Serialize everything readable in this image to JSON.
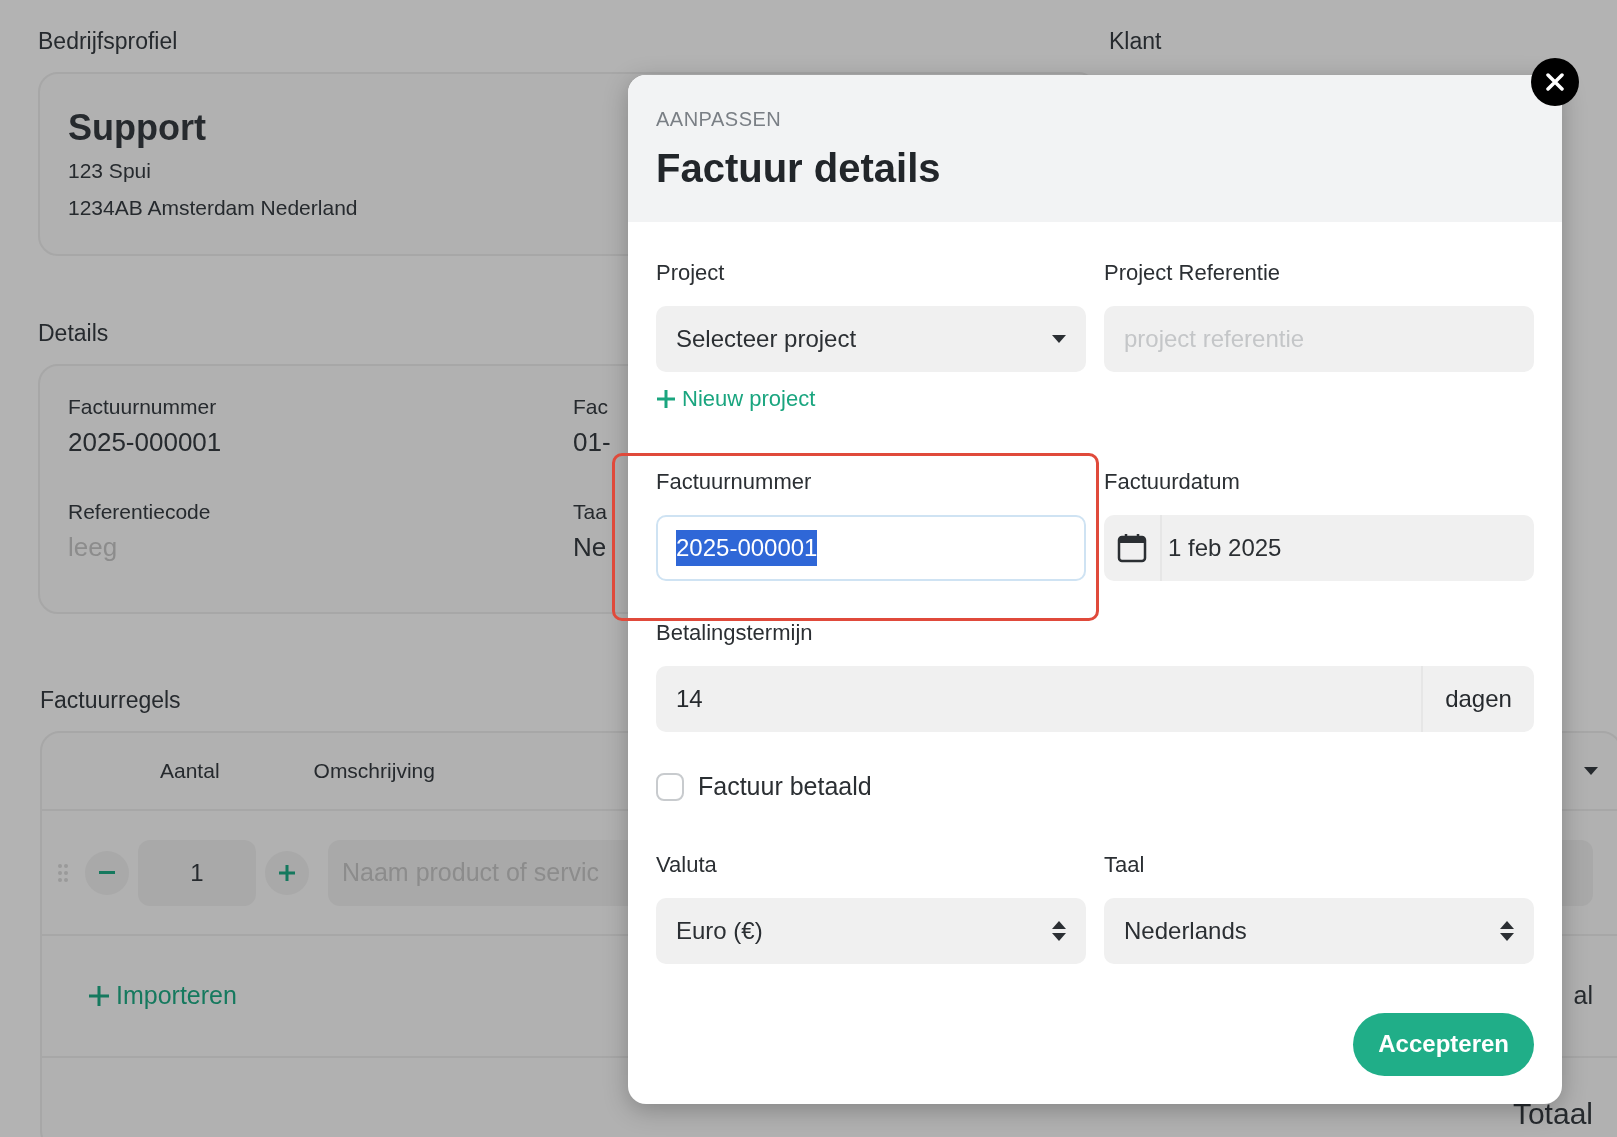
{
  "company_section": {
    "heading": "Bedrijfsprofiel",
    "name": "Support",
    "address_lines": [
      "123 Spui",
      "1234AB Amsterdam Nederland"
    ]
  },
  "client_section": {
    "heading": "Klant"
  },
  "details_section": {
    "heading": "Details",
    "fields": [
      {
        "label": "Factuurnummer",
        "value": "2025-000001",
        "empty": false
      },
      {
        "label": "Fac",
        "value": "01-",
        "empty": false
      },
      {
        "label": "Referentiecode",
        "value": "leeg",
        "empty": true
      },
      {
        "label": "Taa",
        "value": "Ne",
        "empty": false
      }
    ]
  },
  "invoice_lines": {
    "heading": "Factuurregels",
    "columns": [
      "Aantal",
      "Omschrijving"
    ],
    "rows": [
      {
        "quantity": "1",
        "description_placeholder": "Naam product of servic"
      }
    ],
    "import_link": "Importeren",
    "subtotal_label": "al",
    "total_label": "Totaal"
  },
  "modal": {
    "eyebrow": "AANPASSEN",
    "title": "Factuur details",
    "project": {
      "label": "Project",
      "value": "Selecteer project"
    },
    "project_reference": {
      "label": "Project Referentie",
      "placeholder": "project referentie"
    },
    "new_project_link": "Nieuw project",
    "invoice_number": {
      "label": "Factuurnummer",
      "value": "2025-000001",
      "text_selected": true,
      "highlighted": true
    },
    "invoice_date": {
      "label": "Factuurdatum",
      "value": "1 feb 2025"
    },
    "payment_term": {
      "label": "Betalingstermijn",
      "value": "14",
      "suffix": "dagen"
    },
    "paid": {
      "label": "Factuur betaald",
      "checked": false
    },
    "currency": {
      "label": "Valuta",
      "value": "Euro (€)"
    },
    "language": {
      "label": "Taal",
      "value": "Nederlands"
    },
    "accept_button": "Accepteren"
  }
}
